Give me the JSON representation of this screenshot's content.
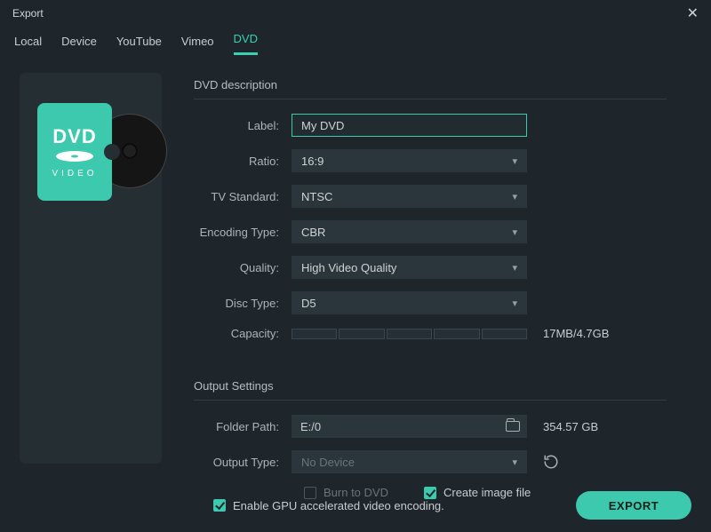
{
  "window": {
    "title": "Export"
  },
  "tabs": {
    "local": "Local",
    "device": "Device",
    "youtube": "YouTube",
    "vimeo": "Vimeo",
    "dvd": "DVD"
  },
  "preview": {
    "dvd_label": "DVD",
    "dvd_sub": "VIDEO"
  },
  "dvd": {
    "section_title": "DVD description",
    "label_lbl": "Label:",
    "label_val": "My DVD",
    "ratio_lbl": "Ratio:",
    "ratio_val": "16:9",
    "tvstd_lbl": "TV Standard:",
    "tvstd_val": "NTSC",
    "enc_lbl": "Encoding Type:",
    "enc_val": "CBR",
    "quality_lbl": "Quality:",
    "quality_val": "High Video Quality",
    "disctype_lbl": "Disc Type:",
    "disctype_val": "D5",
    "capacity_lbl": "Capacity:",
    "capacity_text": "17MB/4.7GB"
  },
  "output": {
    "section_title": "Output Settings",
    "folder_lbl": "Folder Path:",
    "folder_val": "E:/0",
    "folder_free": "354.57 GB",
    "type_lbl": "Output Type:",
    "type_val": "No Device",
    "burn_label": "Burn to DVD",
    "create_image_label": "Create image file"
  },
  "footer": {
    "gpu_label": "Enable GPU accelerated video encoding.",
    "export_btn": "EXPORT"
  }
}
